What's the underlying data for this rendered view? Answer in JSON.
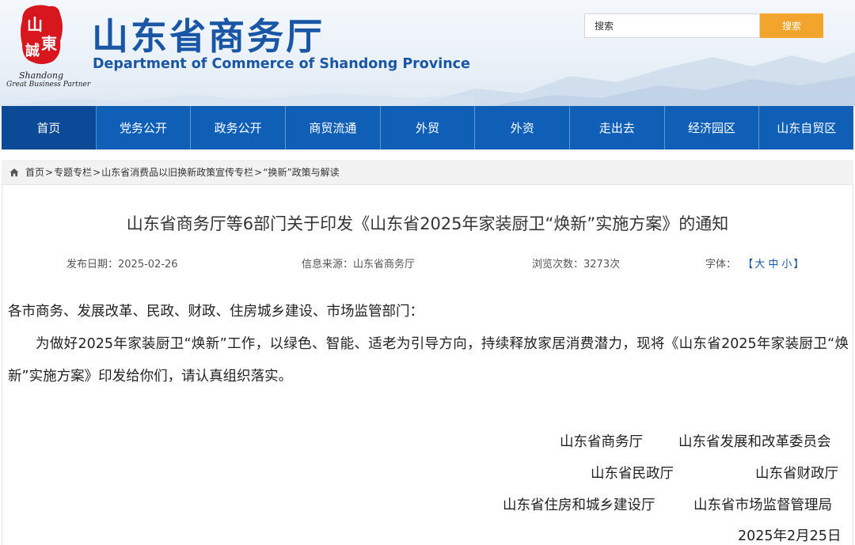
{
  "header": {
    "logo": {
      "seal_text": "山東誠",
      "tag_line_1": "Shandong",
      "tag_line_2": "Great Business Partner",
      "color": "#d7161e"
    },
    "title_cn": "山东省商务厅",
    "title_en": "Department of Commerce of Shandong Province",
    "search": {
      "placeholder": "搜索",
      "button_label": "搜索"
    }
  },
  "nav": {
    "items": [
      {
        "label": "首页"
      },
      {
        "label": "党务公开"
      },
      {
        "label": "政务公开"
      },
      {
        "label": "商贸流通"
      },
      {
        "label": "外贸"
      },
      {
        "label": "外资"
      },
      {
        "label": "走出去"
      },
      {
        "label": "经济园区"
      },
      {
        "label": "山东自贸区"
      }
    ],
    "active_index": 0,
    "color": "#0f5fb6"
  },
  "breadcrumb": {
    "icon": "home-icon",
    "items": [
      "首页",
      "专题专栏",
      "山东省消费品以旧换新政策宣传专栏",
      "“换新”政策与解读"
    ],
    "separator": ">"
  },
  "article": {
    "title": "山东省商务厅等6部门关于印发《山东省2025年家装厨卫“焕新”实施方案》的通知",
    "meta": {
      "date_label": "发布日期：",
      "date": "2025-02-26",
      "source_label": "信息来源：",
      "source": "山东省商务厅",
      "views_label": "浏览次数：",
      "views": "3273次",
      "font_label": "字体：",
      "font_open": "【",
      "font_options": [
        "大",
        "中",
        "小"
      ],
      "font_close": "】"
    },
    "salutation": "各市商务、发展改革、民政、财政、住房城乡建设、市场监管部门：",
    "body": "为做好2025年家装厨卫“焕新”工作，以绿色、智能、适老为引导方向，持续释放家居消费潜力，现将《山东省2025年家装厨卫“焕新”实施方案》印发给你们，请认真组织落实。",
    "signatories": [
      "山东省商务厅",
      "山东省发展和改革委员会",
      "山东省民政厅",
      "山东省财政厅",
      "山东省住房和城乡建设厅",
      "山东省市场监督管理局"
    ],
    "sign_date": "2025年2月25日"
  }
}
